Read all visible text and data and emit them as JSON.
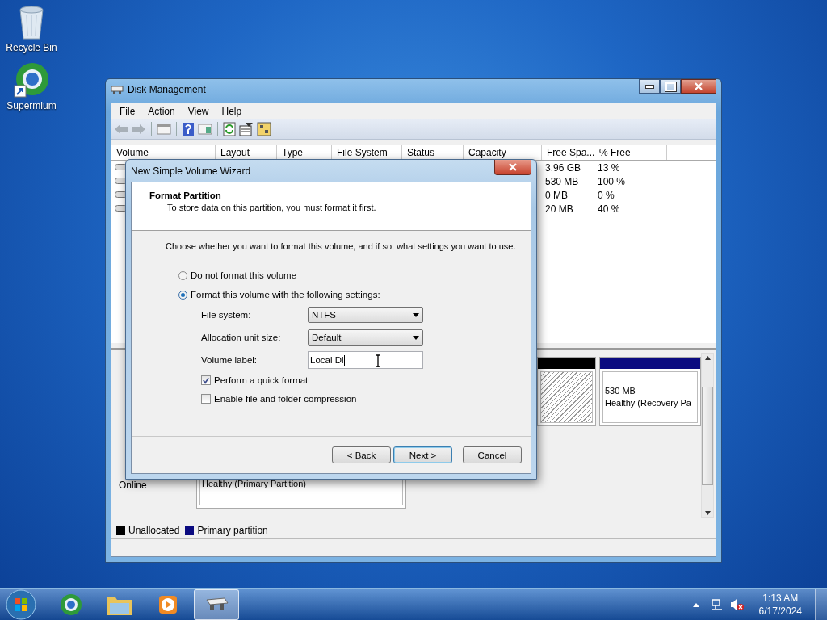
{
  "desktop_icons": [
    {
      "label": "Recycle Bin",
      "kind": "bin"
    },
    {
      "label": "Supermium",
      "kind": "browser"
    }
  ],
  "window": {
    "title": "Disk Management",
    "menu": [
      "File",
      "Action",
      "View",
      "Help"
    ],
    "columns": [
      "Volume",
      "Layout",
      "Type",
      "File System",
      "Status",
      "Capacity",
      "Free Spa...",
      "% Free"
    ],
    "rows": [
      {
        "free": "3.96 GB",
        "pct": "13 %"
      },
      {
        "free": "530 MB",
        "pct": "100 %"
      },
      {
        "free": "0 MB",
        "pct": "0 %"
      },
      {
        "free": "20 MB",
        "pct": "40 %"
      }
    ],
    "disks": [
      {
        "partitions": [
          {
            "kind": "unallocated",
            "color": "#000000"
          },
          {
            "kind": "primary",
            "color": "#0a0a80",
            "size": "530 MB",
            "status": "Healthy (Recovery Pa"
          }
        ]
      },
      {
        "state": "Online",
        "partitions": [
          {
            "kind": "primary",
            "status": "Healthy (Primary Partition)"
          }
        ]
      }
    ],
    "legend": [
      {
        "label": "Unallocated",
        "color": "#000000"
      },
      {
        "label": "Primary partition",
        "color": "#0a0a80"
      }
    ]
  },
  "dialog": {
    "title": "New Simple Volume Wizard",
    "heading": "Format Partition",
    "subtitle": "To store data on this partition, you must format it first.",
    "instruction": "Choose whether you want to format this volume, and if so, what settings you want to use.",
    "options": [
      {
        "label": "Do not format this volume",
        "selected": false
      },
      {
        "label": "Format this volume with the following settings:",
        "selected": true
      }
    ],
    "fields": [
      {
        "kind": "select",
        "label": "File system:",
        "value": "NTFS"
      },
      {
        "kind": "select",
        "label": "Allocation unit size:",
        "value": "Default"
      },
      {
        "kind": "text",
        "label": "Volume label:",
        "value": "Local Di"
      }
    ],
    "checkboxes": [
      {
        "label": "Perform a quick format",
        "checked": true
      },
      {
        "label": "Enable file and folder compression",
        "checked": false
      }
    ],
    "buttons": [
      {
        "label": "< Back",
        "default": false
      },
      {
        "label": "Next >",
        "default": true
      },
      {
        "label": "Cancel",
        "default": false
      }
    ]
  },
  "taskbar": {
    "apps": [
      {
        "kind": "browser",
        "selected": false
      },
      {
        "kind": "folder",
        "selected": false
      },
      {
        "kind": "media",
        "selected": false
      },
      {
        "kind": "disk",
        "selected": true
      }
    ],
    "time": "1:13 AM",
    "date": "6/17/2024"
  }
}
